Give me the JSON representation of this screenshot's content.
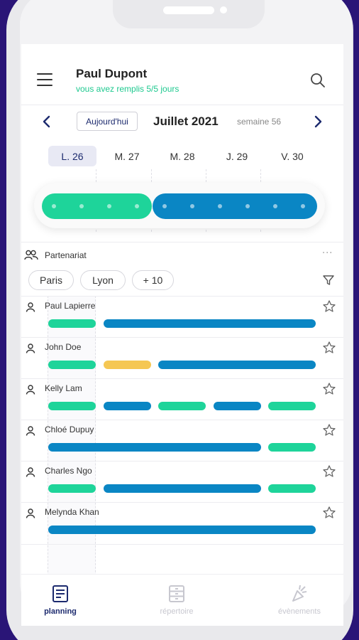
{
  "header": {
    "user_name": "Paul Dupont",
    "status": "vous avez remplis 5/5 jours"
  },
  "week_nav": {
    "today_label": "Aujourd'hui",
    "month": "Juillet 2021",
    "week": "semaine 56"
  },
  "days": [
    {
      "label": "L. 26",
      "active": true
    },
    {
      "label": "M. 27",
      "active": false
    },
    {
      "label": "M. 28",
      "active": false
    },
    {
      "label": "J. 29",
      "active": false
    },
    {
      "label": "V. 30",
      "active": false
    }
  ],
  "summary_slider": {
    "segments": [
      {
        "status": "green",
        "dots": 4
      },
      {
        "status": "blue",
        "dots": 6
      }
    ]
  },
  "team": {
    "name": "Partenariat",
    "more_label": "···",
    "chips": [
      "Paris",
      "Lyon",
      "+ 10"
    ]
  },
  "people": [
    {
      "name": "Paul Lapierre",
      "bars": [
        "green",
        "blue"
      ]
    },
    {
      "name": "John Doe",
      "bars": [
        "green",
        "yellow",
        "blue"
      ]
    },
    {
      "name": "Kelly Lam",
      "bars": [
        "green",
        "blue",
        "green",
        "blue",
        "green"
      ]
    },
    {
      "name": "Chloé Dupuy",
      "bars": [
        "blue",
        "green"
      ]
    },
    {
      "name": "Charles Ngo",
      "bars": [
        "green",
        "blue",
        "green"
      ]
    },
    {
      "name": "Melynda Khan",
      "bars": [
        "blue"
      ]
    }
  ],
  "tabs": [
    {
      "label": "planning",
      "icon": "planning-icon",
      "active": true
    },
    {
      "label": "répertoire",
      "icon": "directory-icon",
      "active": false
    },
    {
      "label": "évènements",
      "icon": "events-icon",
      "active": false
    }
  ],
  "colors": {
    "green": "#1ed49a",
    "blue": "#0a86c4",
    "yellow": "#f5c753",
    "navy": "#1c2a6e",
    "background": "#2a1577"
  }
}
